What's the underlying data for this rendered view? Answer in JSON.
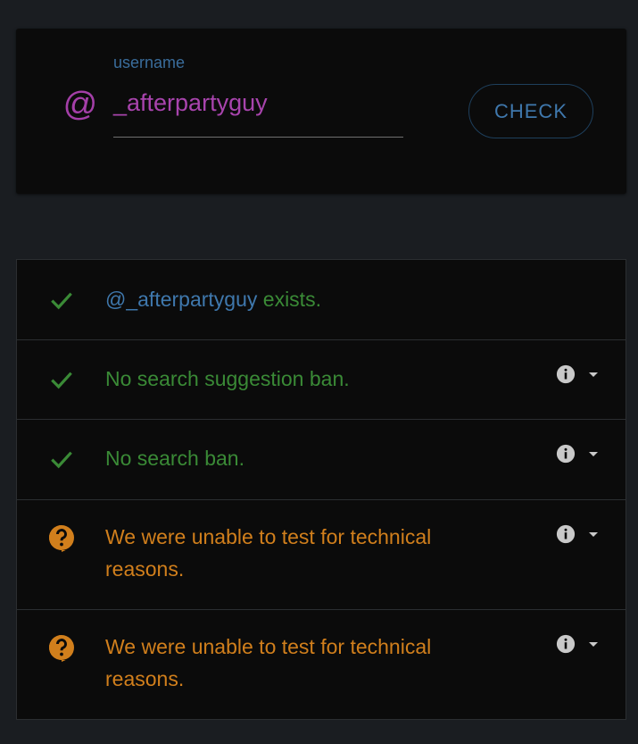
{
  "search": {
    "label": "username",
    "value": "_afterpartyguy",
    "button_label": "CHECK"
  },
  "results": [
    {
      "status": "success",
      "handle": "@_afterpartyguy",
      "text": " exists.",
      "has_details": false
    },
    {
      "status": "success",
      "text": "No search suggestion ban.",
      "has_details": true
    },
    {
      "status": "success",
      "text": "No search ban.",
      "has_details": true
    },
    {
      "status": "unknown",
      "text_line1": "We were unable to test for technical",
      "text_line2": "reasons.",
      "has_details": true
    },
    {
      "status": "unknown",
      "text_line1": "We were unable to test for technical",
      "text_line2": "reasons.",
      "has_details": true
    }
  ],
  "colors": {
    "background": "#1a1d21",
    "card": "#0b0b0b",
    "success": "#3a8a36",
    "handle": "#3f78ad",
    "warning": "#d17f1c",
    "accent": "#a844ad"
  },
  "icons": {
    "username_prefix": "at-sign-icon",
    "success": "checkmark-icon",
    "unknown": "question-bubble-icon",
    "details": "info-icon",
    "expand": "caret-down-icon"
  }
}
